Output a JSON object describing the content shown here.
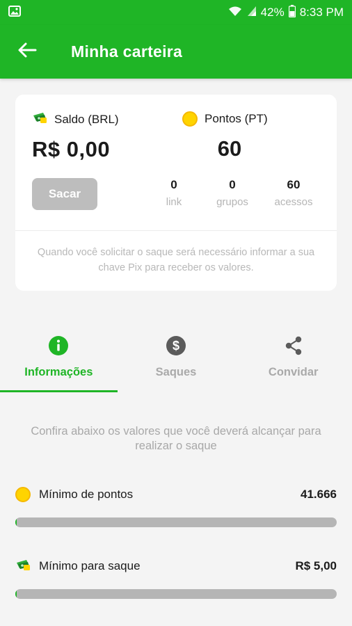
{
  "status_bar": {
    "battery": "42%",
    "time": "8:33 PM"
  },
  "app_bar": {
    "title": "Minha carteira"
  },
  "wallet": {
    "balance_label": "Saldo (BRL)",
    "balance_value": "R$ 0,00",
    "points_label": "Pontos (PT)",
    "points_value": "60",
    "withdraw_label": "Sacar",
    "stats": [
      {
        "value": "0",
        "label": "link"
      },
      {
        "value": "0",
        "label": "grupos"
      },
      {
        "value": "60",
        "label": "acessos"
      }
    ],
    "note": "Quando você solicitar o saque será necessário informar a sua chave Pix para receber os valores."
  },
  "tabs": [
    {
      "label": "Informações",
      "icon": "info-icon",
      "active": true
    },
    {
      "label": "Saques",
      "icon": "dollar-icon",
      "active": false
    },
    {
      "label": "Convidar",
      "icon": "share-icon",
      "active": false
    }
  ],
  "info": {
    "text": "Confira abaixo os valores que você deverá alcançar para realizar o saque"
  },
  "requirements": [
    {
      "label": "Mínimo de pontos",
      "value": "41.666",
      "icon": "coin-icon",
      "progress": 0.0014
    },
    {
      "label": "Mínimo para saque",
      "value": "R$ 5,00",
      "icon": "cash-icon",
      "progress": 0.0
    }
  ],
  "colors": {
    "primary": "#1fb526",
    "coin": "#ffd400",
    "muted": "#b5b5b5",
    "disabled_button": "#bdbdbd"
  }
}
